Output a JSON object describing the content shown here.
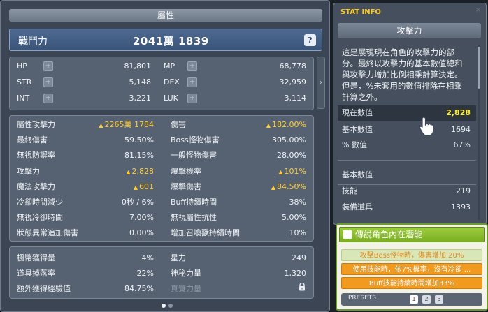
{
  "main": {
    "title": "屬性",
    "power": {
      "label": "戰鬥力",
      "value": "2041萬 1839"
    },
    "help_label": "?",
    "basic_stats": [
      {
        "label": "HP",
        "value": "81,801"
      },
      {
        "label": "MP",
        "value": "68,778"
      },
      {
        "label": "STR",
        "value": "5,148"
      },
      {
        "label": "DEX",
        "value": "32,959"
      },
      {
        "label": "INT",
        "value": "3,221"
      },
      {
        "label": "LUK",
        "value": "3,114"
      }
    ],
    "combat_stats": [
      {
        "label": "屬性攻擊力",
        "value": "2265萬 1784",
        "up": true
      },
      {
        "label": "傷害",
        "value": "182.00%",
        "up": true
      },
      {
        "label": "最終傷害",
        "value": "59.50%",
        "up": false
      },
      {
        "label": "Boss怪物傷害",
        "value": "305.00%",
        "up": false
      },
      {
        "label": "無視防禦率",
        "value": "81.15%",
        "up": false
      },
      {
        "label": "一般怪物傷害",
        "value": "28.00%",
        "up": false
      },
      {
        "label": "攻擊力",
        "value": "2,828",
        "up": true
      },
      {
        "label": "爆擊機率",
        "value": "101%",
        "up": true
      },
      {
        "label": "魔法攻擊力",
        "value": "601",
        "up": true
      },
      {
        "label": "爆擊傷害",
        "value": "84.50%",
        "up": true
      },
      {
        "label": "冷卻時間減少",
        "value": "0秒 / 6%",
        "up": false
      },
      {
        "label": "Buff持續時間",
        "value": "38%",
        "up": false
      },
      {
        "label": "無視冷卻時間",
        "value": "7.00%",
        "up": false
      },
      {
        "label": "無視屬性抗性",
        "value": "5.00%",
        "up": false
      },
      {
        "label": "狀態異常追加傷害",
        "value": "0.00%",
        "up": false
      },
      {
        "label": "增加召喚獸持續時間",
        "value": "10%",
        "up": false
      }
    ],
    "misc_stats": [
      {
        "label": "楓幣獲得量",
        "value": "4%"
      },
      {
        "label": "星力",
        "value": "249"
      },
      {
        "label": "道具掉落率",
        "value": "22%"
      },
      {
        "label": "神秘力量",
        "value": "1,320"
      },
      {
        "label": "額外獲得經驗值",
        "value": "84.75%"
      },
      {
        "label": "真實力量",
        "value": ""
      }
    ],
    "scroll_arrow": "›",
    "pager": {
      "count": 2,
      "active": 0
    }
  },
  "stat_info": {
    "title": "STAT INFO",
    "close": "×",
    "subject": "攻擊力",
    "description": "這是展現現在角色的攻擊力的部分。最終以攻擊力的基本數值總和與攻擊力增加比例相乘計算決定。但是，%未套用的數值排除在相乘計算之外。",
    "rows_top": [
      {
        "label": "現在數值",
        "value": "2,828"
      },
      {
        "label": "基本數值",
        "value": "1694"
      },
      {
        "label": "% 數值",
        "value": "67%"
      }
    ],
    "section2_title": "基本數值",
    "rows_bottom": [
      {
        "label": "技能",
        "value": "219"
      },
      {
        "label": "裝備道具",
        "value": "1393"
      }
    ]
  },
  "potential": {
    "title": "傳說角色內在潛能",
    "lines": [
      "攻擊Boss怪物時，傷害增加 20%",
      "使用技能時，依7%機率，沒有冷卻 ...",
      "Buff技能持續時間增加33%"
    ],
    "presets_label": "PRESETS",
    "presets": [
      "1",
      "2",
      "3"
    ],
    "active_preset": "1"
  },
  "colors": {
    "up_value": "#ffcc33",
    "current_value": "#ffee33",
    "info_title": "#ffcc22",
    "legend_green": "#8cc63a",
    "potential_orange": "#f09a20"
  },
  "icons": [
    "plus-icon",
    "help-icon",
    "lock-icon",
    "hand-cursor-icon",
    "close-icon",
    "legendary-icon"
  ]
}
